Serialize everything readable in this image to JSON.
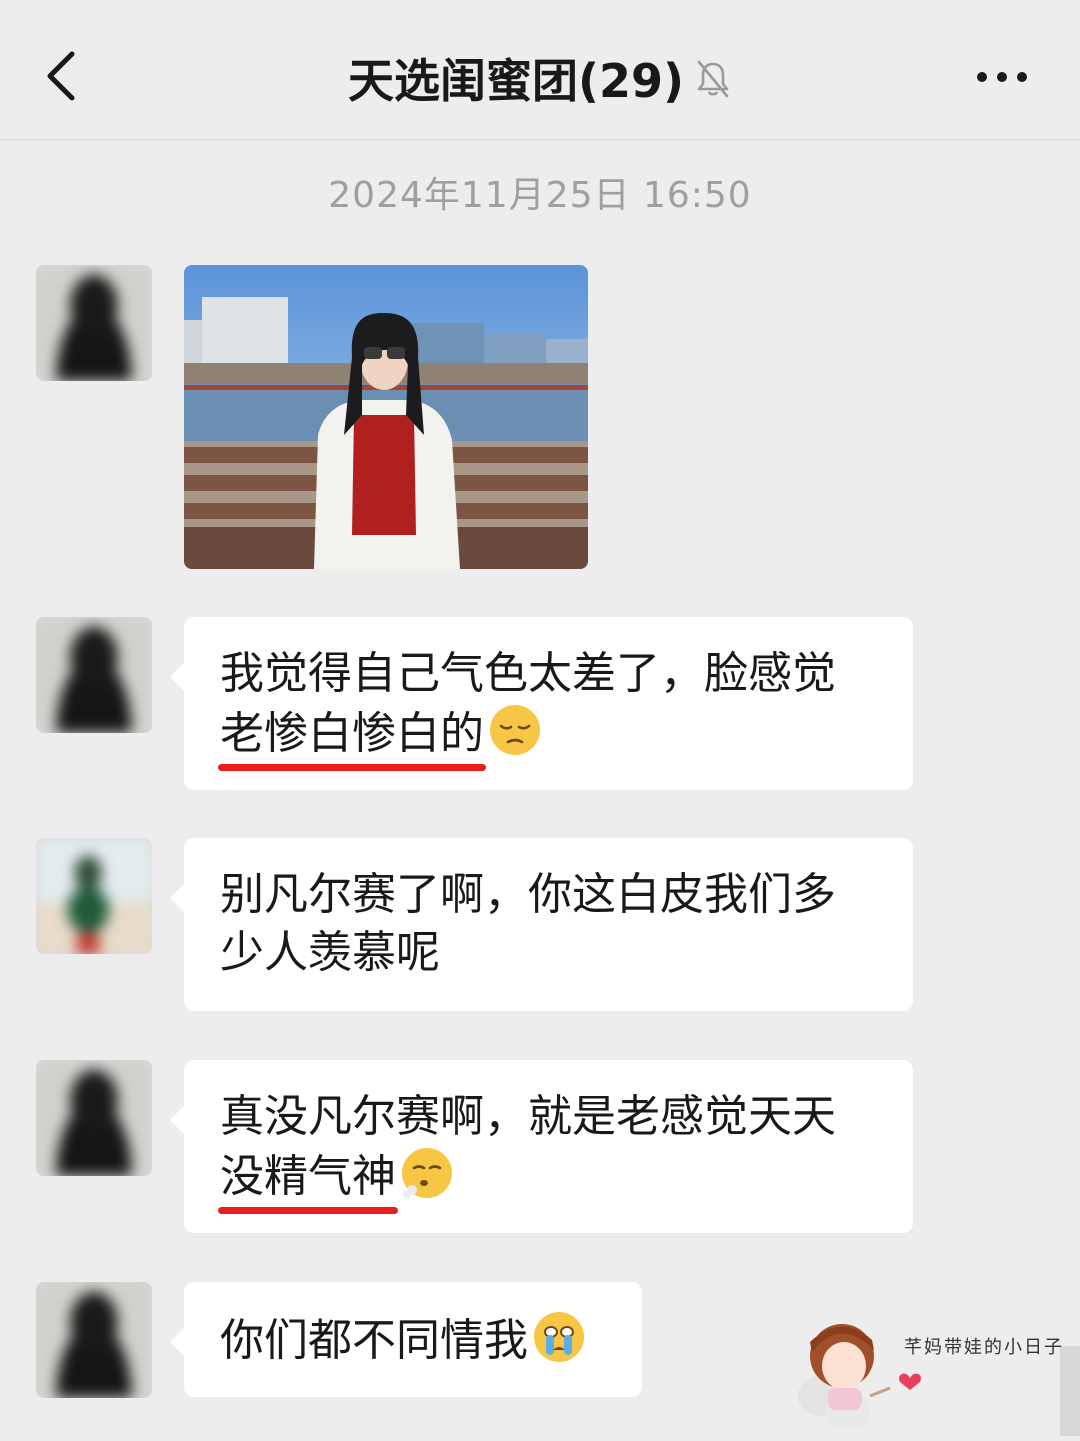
{
  "header": {
    "title": "天选闺蜜团(29)",
    "back_icon": "chevron-left-icon",
    "mute_icon": "bell-off-icon",
    "more_icon": "more-dots-icon"
  },
  "chat": {
    "timestamp": "2024年11月25日 16:50",
    "messages": [
      {
        "type": "image",
        "description_icon": "photo-message"
      },
      {
        "type": "text",
        "line1": "我觉得自己气色太差了，脸感觉",
        "line2_underlined": "老惨白惨白的",
        "emoji": "pensive-face"
      },
      {
        "type": "text",
        "line1": "别凡尔赛了啊，你这白皮我们多",
        "line2": "少人羡慕呢"
      },
      {
        "type": "text",
        "line1": "真没凡尔赛啊，就是老感觉天天",
        "line2_underlined": "没精气神",
        "emoji": "exhale-face"
      },
      {
        "type": "text",
        "line1": "你们都不同情我",
        "emoji": "crying-face"
      }
    ]
  },
  "watermark": {
    "text": "芊妈带娃的小日子"
  },
  "colors": {
    "background": "#ededed",
    "bubble": "#ffffff",
    "underline": "#ee1d1d",
    "timestamp": "#9f9f9f"
  }
}
